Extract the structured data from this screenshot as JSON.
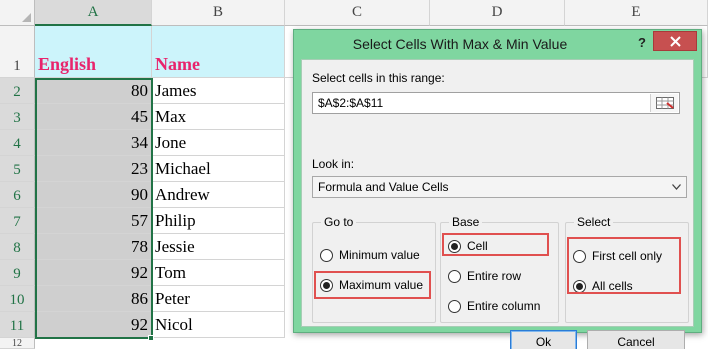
{
  "sheet": {
    "columns": [
      "A",
      "B",
      "C",
      "D",
      "E"
    ],
    "rows": [
      "1",
      "2",
      "3",
      "4",
      "5",
      "6",
      "7",
      "8",
      "9",
      "10",
      "11",
      "12"
    ],
    "header_row": {
      "a": "English",
      "b": "Name"
    },
    "data": [
      {
        "value": "80",
        "name": "James"
      },
      {
        "value": "45",
        "name": "Max"
      },
      {
        "value": "34",
        "name": "Jone"
      },
      {
        "value": "23",
        "name": "Michael"
      },
      {
        "value": "90",
        "name": "Andrew"
      },
      {
        "value": "57",
        "name": "Philip"
      },
      {
        "value": "78",
        "name": "Jessie"
      },
      {
        "value": "92",
        "name": "Tom"
      },
      {
        "value": "86",
        "name": "Peter"
      },
      {
        "value": "92",
        "name": "Nicol"
      }
    ]
  },
  "dialog": {
    "title": "Select Cells With Max & Min Value",
    "help": "?",
    "range_label": "Select cells in this range:",
    "range_value": "$A$2:$A$11",
    "lookin_label": "Look in:",
    "lookin_value": "Formula and Value Cells",
    "goto": {
      "title": "Go to",
      "min": "Minimum value",
      "max": "Maximum value",
      "selected": "max"
    },
    "base": {
      "title": "Base",
      "cell": "Cell",
      "row": "Entire row",
      "column": "Entire column",
      "selected": "cell"
    },
    "select": {
      "title": "Select",
      "first": "First cell only",
      "all": "All cells",
      "selected": "all"
    },
    "ok": "Ok",
    "cancel": "Cancel"
  },
  "colors": {
    "header_fill": "#ccf4fb",
    "header_text": "#e8246c",
    "dialog_frame": "#7fd6a0",
    "highlight_box": "#e0504f",
    "selection": "#217346"
  }
}
